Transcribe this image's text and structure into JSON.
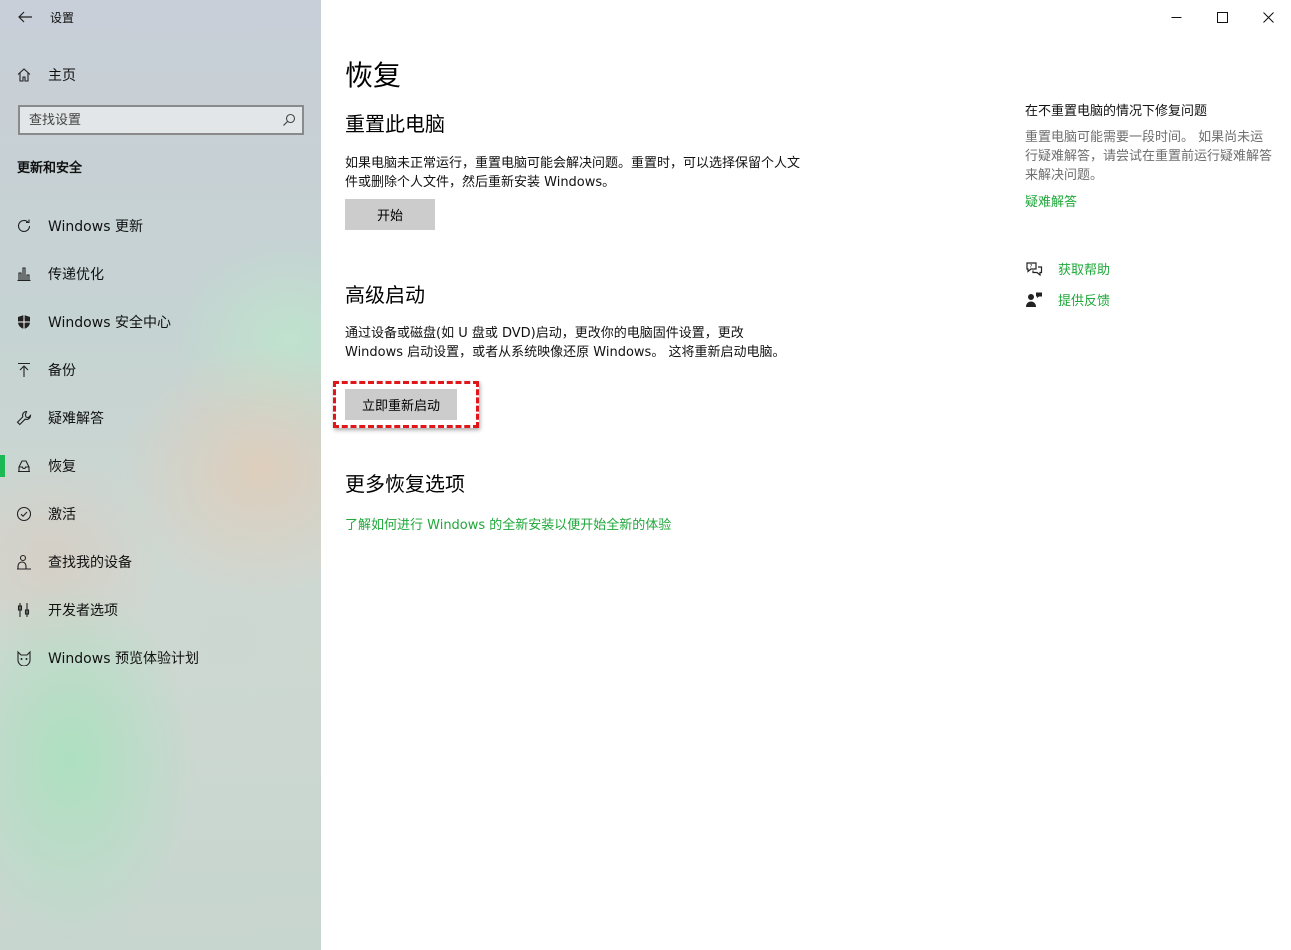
{
  "window": {
    "title": "设置",
    "controls": {
      "minimize": "minimize-icon",
      "maximize": "maximize-icon",
      "close": "close-icon"
    }
  },
  "sidebar": {
    "home_label": "主页",
    "search_placeholder": "查找设置",
    "section_heading": "更新和安全",
    "items": [
      {
        "label": "Windows 更新",
        "icon": "refresh-icon"
      },
      {
        "label": "传递优化",
        "icon": "delivery-optimization-icon"
      },
      {
        "label": "Windows 安全中心",
        "icon": "shield-icon"
      },
      {
        "label": "备份",
        "icon": "upload-arrow-icon"
      },
      {
        "label": "疑难解答",
        "icon": "wrench-icon"
      },
      {
        "label": "恢复",
        "icon": "recovery-icon",
        "active": true
      },
      {
        "label": "激活",
        "icon": "check-circle-icon"
      },
      {
        "label": "查找我的设备",
        "icon": "person-location-icon"
      },
      {
        "label": "开发者选项",
        "icon": "developer-tools-icon"
      },
      {
        "label": "Windows 预览体验计划",
        "icon": "insider-cat-icon"
      }
    ]
  },
  "main": {
    "page_title": "恢复",
    "reset": {
      "heading": "重置此电脑",
      "description": "如果电脑未正常运行，重置电脑可能会解决问题。重置时，可以选择保留个人文件或删除个人文件，然后重新安装 Windows。",
      "button_label": "开始"
    },
    "advanced": {
      "heading": "高级启动",
      "description": "通过设备或磁盘(如 U 盘或 DVD)启动，更改你的电脑固件设置，更改 Windows 启动设置，或者从系统映像还原 Windows。 这将重新启动电脑。",
      "button_label": "立即重新启动"
    },
    "more": {
      "heading": "更多恢复选项",
      "link": "了解如何进行 Windows 的全新安装以便开始全新的体验"
    }
  },
  "right_pane": {
    "title": "在不重置电脑的情况下修复问题",
    "description": "重置电脑可能需要一段时间。 如果尚未运行疑难解答，请尝试在重置前运行疑难解答来解决问题。",
    "troubleshoot_link": "疑难解答",
    "get_help": "获取帮助",
    "feedback": "提供反馈"
  },
  "colors": {
    "accent_green": "#1fa83a",
    "active_bar": "#1db954",
    "highlight_red": "#e0161b"
  }
}
